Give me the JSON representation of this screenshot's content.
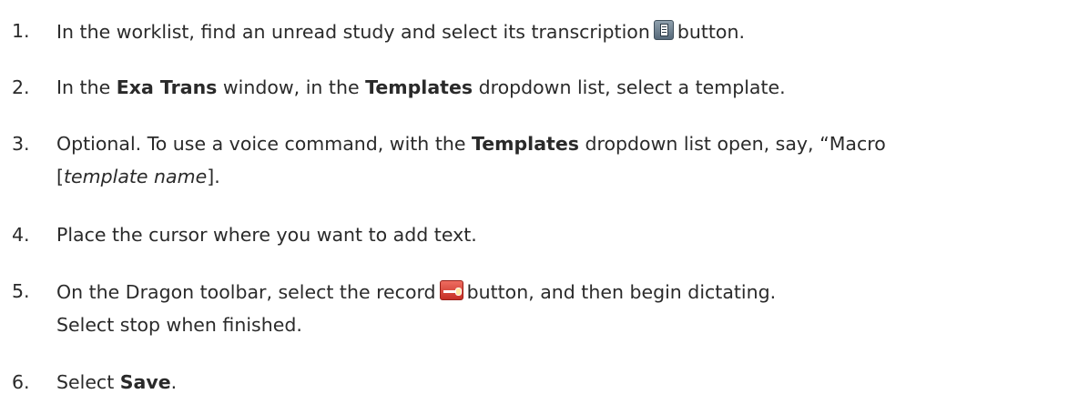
{
  "steps": [
    {
      "number": "1.",
      "before": "In the worklist, find an unread study and select its transcription",
      "icon": "transcription-icon",
      "after": "button."
    },
    {
      "number": "2.",
      "pre": "In the ",
      "bold1": "Exa Trans",
      "mid": " window, in the ",
      "bold2": "Templates",
      "post": " dropdown list, select a template."
    },
    {
      "number": "3.",
      "pre": "Optional. To use a voice command, with the ",
      "bold": "Templates",
      "post": " dropdown list open, say, “Macro",
      "line2_open": "[",
      "italic": "template name",
      "line2_close": "]."
    },
    {
      "number": "4.",
      "text": "Place the cursor where you want to add text."
    },
    {
      "number": "5.",
      "before": "On the Dragon toolbar, select the record",
      "icon": "record-icon",
      "after": "button, and then begin dictating.",
      "line2": "Select stop when finished."
    },
    {
      "number": "6.",
      "pre": "Select ",
      "bold": "Save",
      "post": "."
    }
  ]
}
